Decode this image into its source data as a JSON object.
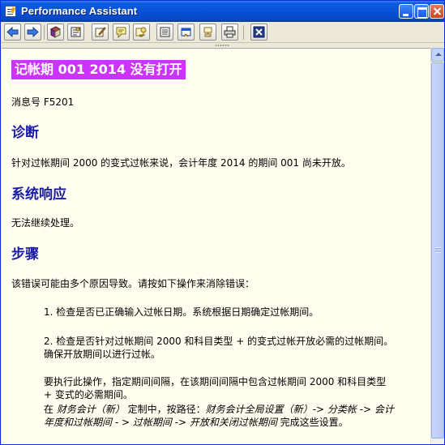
{
  "window": {
    "title": "Performance Assistant"
  },
  "toolbar": {
    "buttons": [
      {
        "name": "back-icon"
      },
      {
        "name": "forward-icon"
      },
      {
        "name": "book-icon"
      },
      {
        "name": "tech-info-icon"
      },
      {
        "name": "edit-icon"
      },
      {
        "name": "note-icon"
      },
      {
        "name": "help-icon"
      },
      {
        "name": "list-icon"
      },
      {
        "name": "window-icon"
      },
      {
        "name": "settings-icon"
      },
      {
        "name": "print-icon"
      },
      {
        "name": "close-icon"
      }
    ]
  },
  "document": {
    "title": "记帐期  001 2014 没有打开",
    "message_no": "消息号  F5201",
    "diagnosis_heading": "诊断",
    "diagnosis_text": "针对过帐期间  2000 的变式过帐来说，会计年度  2014 的期间  001 尚未开放。",
    "response_heading": "系统响应",
    "response_text": "无法继续处理。",
    "procedure_heading": "步骤",
    "procedure_intro": "该错误可能由多个原因导致。请按如下操作来消除错误：",
    "step1": "1. 检查是否已正确输入过帐日期。系统根据日期确定过帐期间。",
    "step2_line1": "2. 检查是否针对过帐期间  2000 和科目类型  + 的变式过帐开放必需的过帐期间。",
    "step2_line2": "确保开放期间以进行过帐。",
    "exec_line1": "要执行此操作，指定期间间隔，在该期间间隔中包含过帐期间  2000 和科目类型",
    "exec_line2": "+ 变式的必需期间。",
    "path_prefix": "在  ",
    "path_italic1": "财务会计（新）",
    "path_mid": "  定制中，按路径：",
    "path_italic2": "财务会计全局设置（新）-> 分类帐 -> 会计",
    "path_line2_italic": "年度和过帐期间 - > 过帐期间 -> 开放和关闭过帐期间",
    "path_line2_suffix": " 完成这些设置。"
  }
}
